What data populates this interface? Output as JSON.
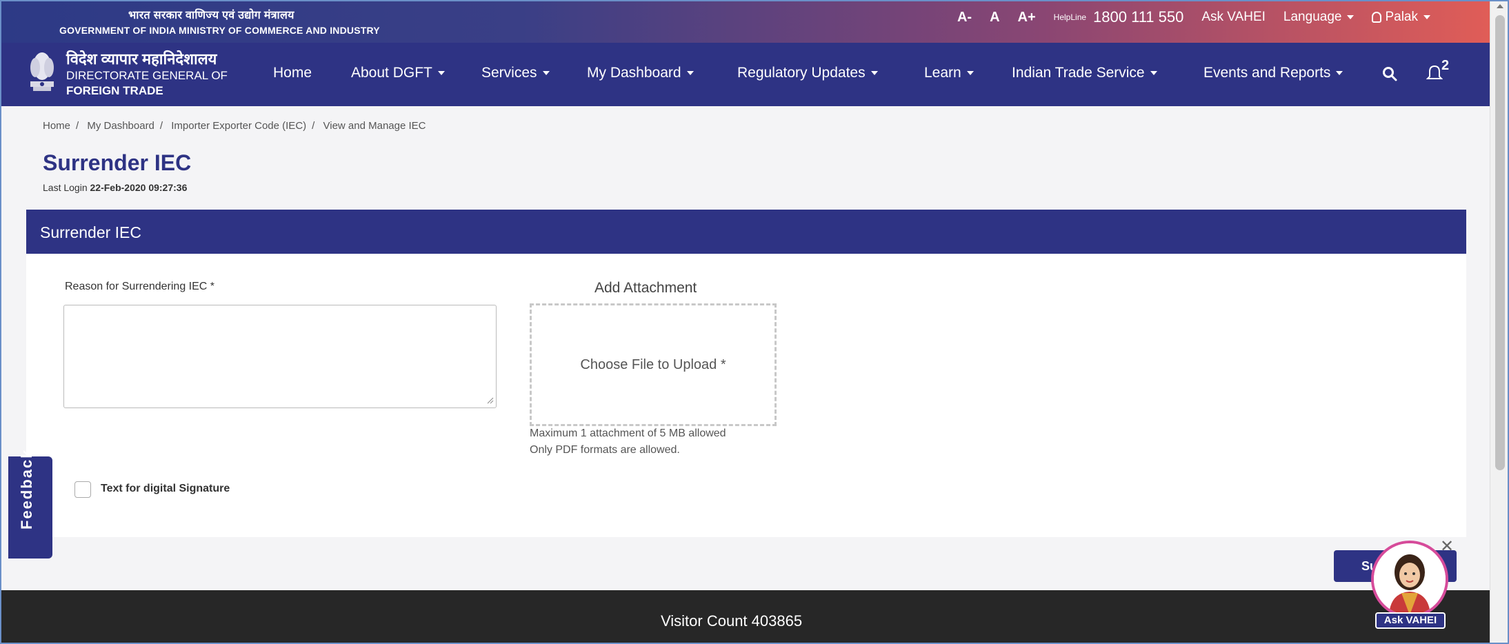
{
  "topbar": {
    "gov_hindi": "भारत सरकार  वाणिज्य एवं उद्योग मंत्रालय",
    "gov_english": "GOVERNMENT OF INDIA  MINISTRY OF COMMERCE AND INDUSTRY",
    "font_small": "A-",
    "font_normal": "A",
    "font_large": "A+",
    "helpline_label": "HelpLine",
    "helpline_number": "1800 111 550",
    "ask_vahei": "Ask VAHEI",
    "language": "Language",
    "user": "Palak"
  },
  "nav": {
    "brand_hindi": "विदेश व्यापार महानिदेशालय",
    "brand_line1": "DIRECTORATE GENERAL OF",
    "brand_line2": "FOREIGN TRADE",
    "items": [
      {
        "label": "Home",
        "dropdown": false
      },
      {
        "label": "About DGFT",
        "dropdown": true
      },
      {
        "label": "Services",
        "dropdown": true
      },
      {
        "label": "My Dashboard",
        "dropdown": true
      },
      {
        "label": "Regulatory Updates",
        "dropdown": true
      },
      {
        "label": "Learn",
        "dropdown": true
      },
      {
        "label": "Indian Trade Service",
        "dropdown": true
      },
      {
        "label": "Events and Reports",
        "dropdown": true
      }
    ],
    "notification_count": "2"
  },
  "breadcrumb": [
    "Home",
    "My Dashboard",
    "Importer Exporter Code (IEC)",
    "View and Manage IEC"
  ],
  "page": {
    "title": "Surrender IEC",
    "last_login_label": "Last Login",
    "last_login_value": "22-Feb-2020 09:27:36"
  },
  "form": {
    "header": "Surrender IEC",
    "reason_label": "Reason for Surrendering IEC *",
    "reason_value": "",
    "attachment_title": "Add Attachment",
    "upload_label": "Choose File to Upload *",
    "attachment_note1": "Maximum 1 attachment of 5 MB allowed",
    "attachment_note2": "Only PDF formats are allowed.",
    "digital_signature_label": "Text for digital Signature",
    "submit_label": "Submit"
  },
  "footer": {
    "visitor_count": "Visitor Count 403865"
  },
  "feedback_label": "Feedback",
  "bot_label": "Ask VAHEI",
  "colors": {
    "primary": "#2e3384",
    "topbar_gradient_end": "#e05d57",
    "footer": "#272727",
    "bot_border": "#d64b9a"
  }
}
